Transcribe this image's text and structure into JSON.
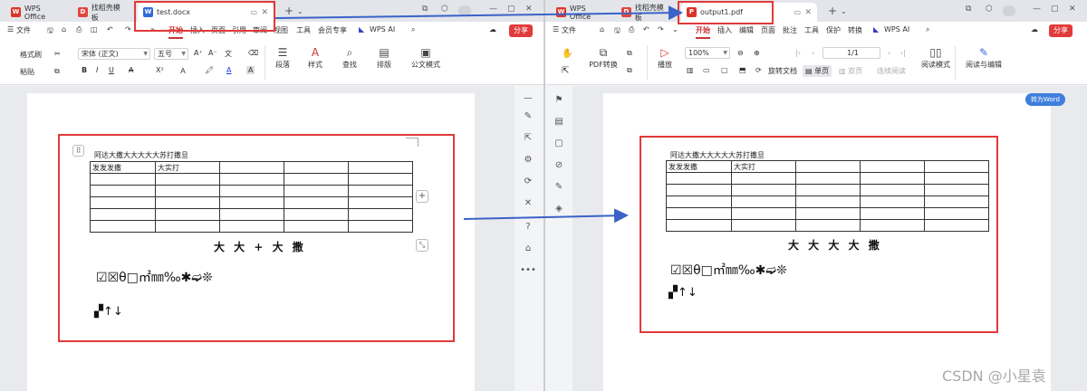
{
  "left": {
    "tabs": [
      {
        "label": "WPS Office"
      },
      {
        "label": "找稻壳模板"
      },
      {
        "label": "test.docx"
      }
    ],
    "menu": {
      "file": "文件",
      "items": [
        "开始",
        "插入",
        "页面",
        "引用",
        "审阅",
        "视图",
        "工具",
        "会员专享"
      ],
      "wps_ai": "WPS AI",
      "share": "分享"
    },
    "ribbon": {
      "format_painter": "格式刷",
      "paste": "粘贴",
      "font_name": "宋体 (正文)",
      "font_size": "五号",
      "paragraph": "段落",
      "style": "样式",
      "find": "查找",
      "layout": "排版",
      "official_doc": "公文模式"
    },
    "document": {
      "heading_line": "阿达大撒大大大大大苏打撒旦",
      "table": [
        [
          "发发发撒",
          "大实打",
          "",
          "",
          ""
        ],
        [
          "",
          "",
          "",
          "",
          ""
        ],
        [
          "",
          "",
          "",
          "",
          ""
        ],
        [
          "",
          "",
          "",
          "",
          ""
        ],
        [
          "",
          "",
          "",
          "",
          ""
        ],
        [
          "",
          "",
          "",
          "",
          ""
        ]
      ],
      "big_line": "大 大 + 大 撒",
      "symbol_line": "☑☒θ□㎡㎜‰✱➫❊",
      "symbol_line2": "▞↑↓"
    }
  },
  "right": {
    "tabs": [
      {
        "label": "WPS Office"
      },
      {
        "label": "找稻壳模板"
      },
      {
        "label": "output1.pdf"
      }
    ],
    "menu": {
      "file": "文件",
      "items": [
        "开始",
        "插入",
        "编辑",
        "页面",
        "批注",
        "工具",
        "保护",
        "转换"
      ],
      "wps_ai": "WPS AI",
      "share": "分享"
    },
    "ribbon": {
      "pdf_convert": "PDF转换",
      "play": "播放",
      "zoom": "100%",
      "page": "1/1",
      "rotate": "旋转文档",
      "single": "单页",
      "double": "双页",
      "continuous": "连续阅读",
      "read_mode": "阅读模式",
      "read_edit": "阅读与编辑"
    },
    "to_word": "转为Word",
    "document": {
      "heading_line": "阿达大撒大大大大大苏打撒旦",
      "table": [
        [
          "发发发撒",
          "大实打",
          "",
          "",
          ""
        ],
        [
          "",
          "",
          "",
          "",
          ""
        ],
        [
          "",
          "",
          "",
          "",
          ""
        ],
        [
          "",
          "",
          "",
          "",
          ""
        ],
        [
          "",
          "",
          "",
          "",
          ""
        ],
        [
          "",
          "",
          "",
          "",
          ""
        ]
      ],
      "big_line": "大 大 大 大 撒",
      "symbol_line": "☑☒θ□㎡㎜‰✱➫❊",
      "symbol_line2": "▞↑↓"
    }
  },
  "watermark": "CSDN @小星袁",
  "colors": {
    "accent_red": "#e03a3a",
    "arrow_blue": "#3a63c8",
    "wps_red": "#d9342b"
  }
}
